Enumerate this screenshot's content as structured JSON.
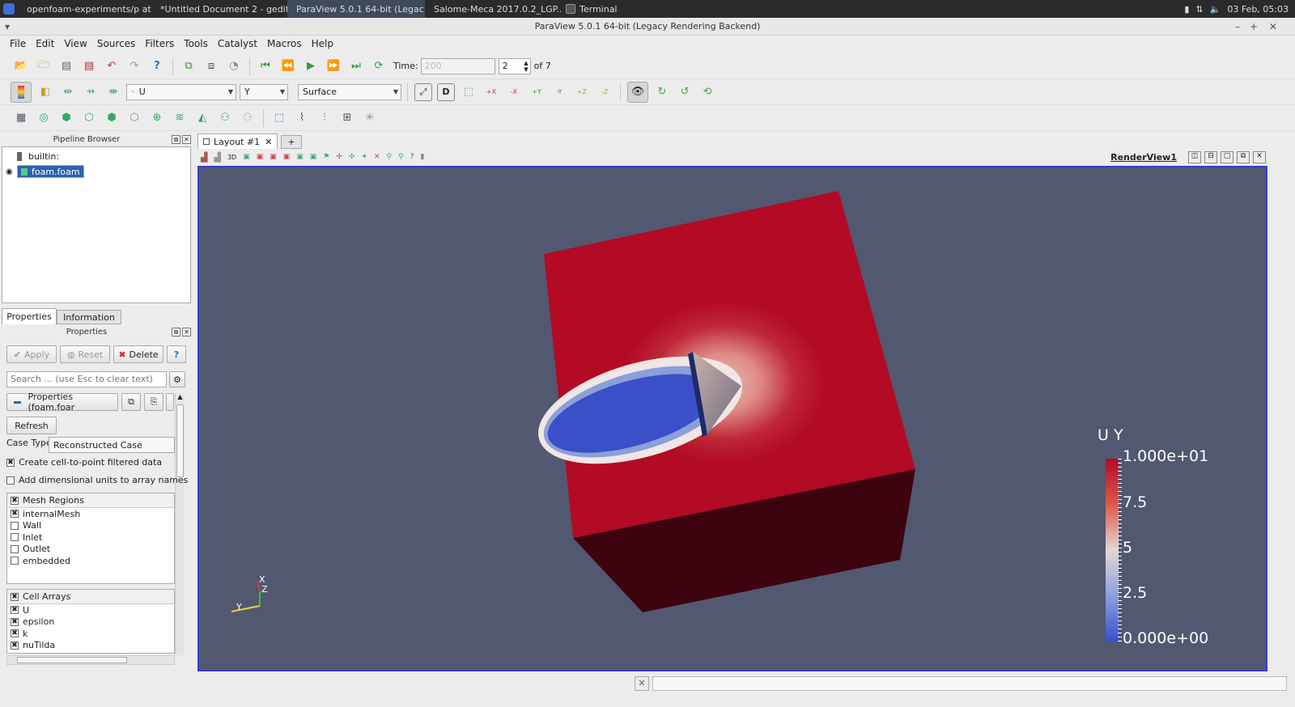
{
  "taskbar": {
    "tasks": [
      {
        "label": "openfoam-experiments/p at ...",
        "color": "#e07a2a"
      },
      {
        "label": "*Untitled Document 2 - gedit",
        "color": "#cfcfcf"
      },
      {
        "label": "ParaView 5.0.1 64-bit (Legac...",
        "color": "#2d6fc1"
      },
      {
        "label": "Salome-Meca 2017.0.2_LGP...",
        "color": "#d0b24a"
      },
      {
        "label": "Terminal",
        "color": "#555555"
      }
    ],
    "clock": "03 Feb, 05:03"
  },
  "window": {
    "title": "ParaView 5.0.1 64-bit (Legacy Rendering Backend)"
  },
  "menu": [
    "File",
    "Edit",
    "View",
    "Sources",
    "Filters",
    "Tools",
    "Catalyst",
    "Macros",
    "Help"
  ],
  "time_toolbar": {
    "time_label": "Time:",
    "time_value": "200",
    "step_value": "2",
    "of_label": "of 7"
  },
  "representation": {
    "array": "U",
    "component": "Y",
    "mode": "Surface"
  },
  "camera_labels": [
    "+X",
    "-X",
    "+Y",
    "-Y",
    "+Z",
    "-Z"
  ],
  "pipeline": {
    "title": "Pipeline Browser",
    "items": [
      {
        "label": "builtin:"
      },
      {
        "label": "foam.foam"
      }
    ]
  },
  "properties": {
    "tabs": [
      "Properties",
      "Information"
    ],
    "title": "Properties",
    "apply": "Apply",
    "reset": "Reset",
    "delete": "Delete",
    "help": "?",
    "search_placeholder": "Search ... (use Esc to clear text)",
    "section": "Properties (foam.foar",
    "refresh": "Refresh",
    "case_type_label": "Case Type",
    "case_type_value": "Reconstructed Case",
    "options": [
      {
        "label": "Create cell-to-point filtered data",
        "checked": true
      },
      {
        "label": "Add dimensional units to array names",
        "checked": false
      }
    ],
    "mesh_regions": {
      "header": "Mesh Regions",
      "items": [
        {
          "label": "internalMesh",
          "checked": true
        },
        {
          "label": "Wall",
          "checked": false
        },
        {
          "label": "Inlet",
          "checked": false
        },
        {
          "label": "Outlet",
          "checked": false
        },
        {
          "label": "embedded",
          "checked": false
        }
      ]
    },
    "cell_arrays": {
      "header": "Cell Arrays",
      "items": [
        {
          "label": "U",
          "checked": true
        },
        {
          "label": "epsilon",
          "checked": true
        },
        {
          "label": "k",
          "checked": true
        },
        {
          "label": "nuTilda",
          "checked": true
        }
      ]
    }
  },
  "layout": {
    "tab": "Layout #1",
    "plus": "+",
    "view_name": "RenderView1",
    "mode_3d": "3D"
  },
  "colorbar": {
    "title": "U Y",
    "labels": [
      "1.000e+01",
      "7.5",
      "5",
      "2.5",
      "0.000e+00"
    ]
  },
  "axes": {
    "x": "X",
    "y": "Y",
    "z": "Z"
  },
  "colors": {
    "background": "#525870",
    "high": "#b30a26",
    "low": "#3a4fc8",
    "accent": "#3a3ad0"
  }
}
